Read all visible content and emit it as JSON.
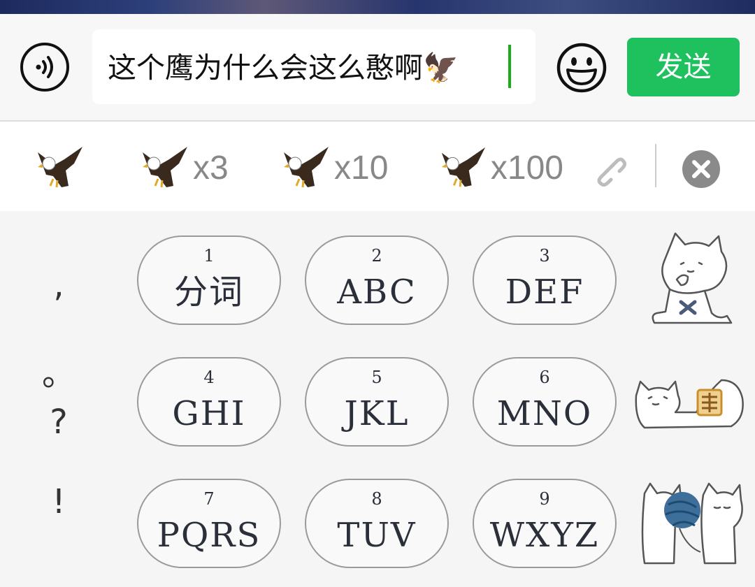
{
  "input_bar": {
    "text": "这个鹰为什么会这么憨啊🦅",
    "send_label": "发送"
  },
  "suggestions": [
    {
      "icon": "eagle-icon",
      "label": ""
    },
    {
      "icon": "eagle-icon",
      "label": "x3"
    },
    {
      "icon": "eagle-icon",
      "label": "x10"
    },
    {
      "icon": "eagle-icon",
      "label": "x100"
    }
  ],
  "punctuation": [
    ",",
    "。",
    "?",
    "!"
  ],
  "keys": [
    {
      "num": "1",
      "letters": "分词"
    },
    {
      "num": "2",
      "letters": "ABC"
    },
    {
      "num": "3",
      "letters": "DEF"
    },
    {
      "num": "4",
      "letters": "GHI"
    },
    {
      "num": "5",
      "letters": "JKL"
    },
    {
      "num": "6",
      "letters": "MNO"
    },
    {
      "num": "7",
      "letters": "PQRS"
    },
    {
      "num": "8",
      "letters": "TUV"
    },
    {
      "num": "9",
      "letters": "WXYZ"
    }
  ],
  "colors": {
    "send": "#1fc15f",
    "cursor": "#1aad19",
    "key_border": "#9a9a9a"
  }
}
